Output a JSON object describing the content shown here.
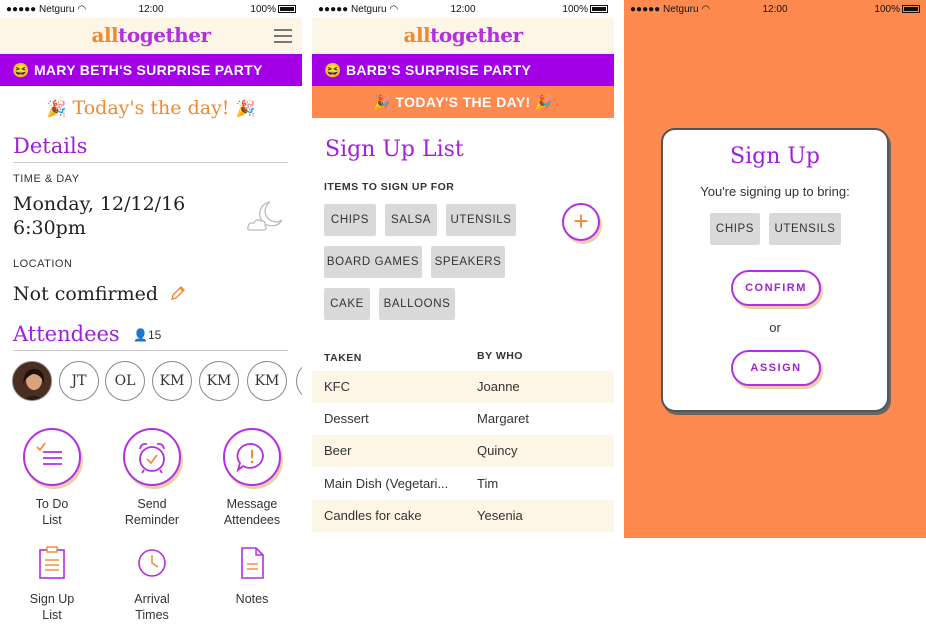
{
  "status": {
    "carrier": "Netguru",
    "time": "12:00",
    "battery": "100%"
  },
  "logo": {
    "part1": "all",
    "part2": "together"
  },
  "colors": {
    "purple": "#a300e8",
    "orange": "#ff8a4f",
    "cream": "#fdf5e6"
  },
  "screen1": {
    "event_title": "MARY BETH'S SURPRISE PARTY",
    "today": "Today's the day!",
    "details_heading": "Details",
    "time_label": "TIME & DAY",
    "date": "Monday, 12/12/16",
    "time": "6:30pm",
    "location_label": "LOCATION",
    "location_value": "Not comfirmed",
    "attendees_heading": "Attendees",
    "attendee_count": "15",
    "attendees": [
      "JT",
      "OL",
      "KM",
      "KM",
      "KM"
    ],
    "actions": [
      {
        "line1": "To Do",
        "line2": "List",
        "icon": "list-icon"
      },
      {
        "line1": "Send",
        "line2": "Reminder",
        "icon": "alarm-clock-icon"
      },
      {
        "line1": "Message",
        "line2": "Attendees",
        "icon": "message-icon"
      },
      {
        "line1": "Sign Up",
        "line2": "List",
        "icon": "clipboard-icon"
      },
      {
        "line1": "Arrival",
        "line2": "Times",
        "icon": "clock-icon"
      },
      {
        "line1": "Notes",
        "line2": "",
        "icon": "notes-icon"
      }
    ]
  },
  "screen2": {
    "event_title": "BARB'S SURPRISE PARTY",
    "today": "TODAY'S THE DAY!",
    "heading": "Sign Up List",
    "items_label": "ITEMS TO SIGN UP FOR",
    "chips": [
      "CHIPS",
      "SALSA",
      "UTENSILS",
      "BOARD GAMES",
      "SPEAKERS",
      "CAKE",
      "BALLOONS"
    ],
    "table_headers": [
      "TAKEN",
      "BY WHO"
    ],
    "rows": [
      [
        "KFC",
        "Joanne"
      ],
      [
        "Dessert",
        "Margaret"
      ],
      [
        "Beer",
        "Quincy"
      ],
      [
        "Main Dish (Vegetari...",
        "Tim"
      ],
      [
        "Candles for cake",
        "Yesenia"
      ]
    ]
  },
  "screen3": {
    "title": "Sign Up",
    "subtitle": "You're signing up to bring:",
    "chips": [
      "CHIPS",
      "UTENSILS"
    ],
    "confirm": "CONFIRM",
    "or": "or",
    "assign": "ASSIGN"
  }
}
